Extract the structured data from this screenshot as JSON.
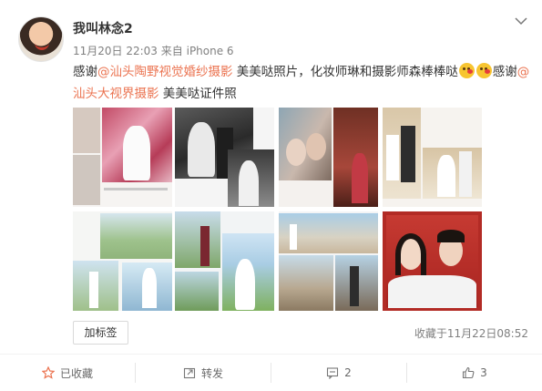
{
  "post": {
    "username": "我叫林念2",
    "timestamp": "11月20日 22:03",
    "source_prefix": "来自",
    "source": "iPhone 6",
    "text_1": "感谢",
    "mention_1": "@汕头陶野视觉婚纱摄影",
    "text_2": " 美美哒照片，化妆师琳和摄影师森棒棒哒",
    "text_3": "感谢",
    "mention_2": "@汕头大视界摄影",
    "text_4": " 美美哒证件照",
    "emoji_name": "kiss-emoji"
  },
  "footer": {
    "tag_button": "加标签",
    "favorite_time": "收藏于11月22日08:52"
  },
  "actions": {
    "favorite": "已收藏",
    "repost": "转发",
    "comment_count": "2",
    "like_count": "3"
  },
  "colors": {
    "mention": "#eb7350",
    "favorite_star": "#eb7350",
    "meta_text": "#808080"
  }
}
